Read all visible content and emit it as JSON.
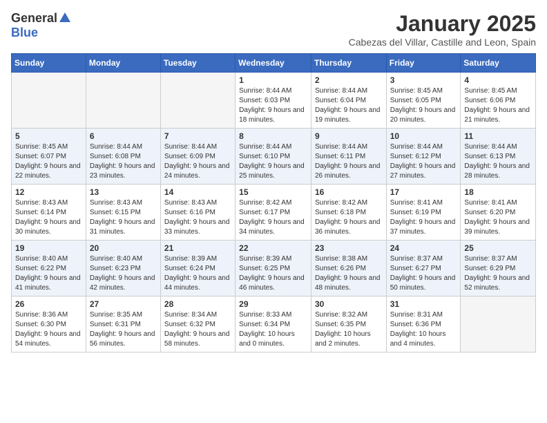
{
  "header": {
    "logo_general": "General",
    "logo_blue": "Blue",
    "month": "January 2025",
    "location": "Cabezas del Villar, Castille and Leon, Spain"
  },
  "weekdays": [
    "Sunday",
    "Monday",
    "Tuesday",
    "Wednesday",
    "Thursday",
    "Friday",
    "Saturday"
  ],
  "weeks": [
    [
      {
        "day": "",
        "info": ""
      },
      {
        "day": "",
        "info": ""
      },
      {
        "day": "",
        "info": ""
      },
      {
        "day": "1",
        "info": "Sunrise: 8:44 AM\nSunset: 6:03 PM\nDaylight: 9 hours and 18 minutes."
      },
      {
        "day": "2",
        "info": "Sunrise: 8:44 AM\nSunset: 6:04 PM\nDaylight: 9 hours and 19 minutes."
      },
      {
        "day": "3",
        "info": "Sunrise: 8:45 AM\nSunset: 6:05 PM\nDaylight: 9 hours and 20 minutes."
      },
      {
        "day": "4",
        "info": "Sunrise: 8:45 AM\nSunset: 6:06 PM\nDaylight: 9 hours and 21 minutes."
      }
    ],
    [
      {
        "day": "5",
        "info": "Sunrise: 8:45 AM\nSunset: 6:07 PM\nDaylight: 9 hours and 22 minutes."
      },
      {
        "day": "6",
        "info": "Sunrise: 8:44 AM\nSunset: 6:08 PM\nDaylight: 9 hours and 23 minutes."
      },
      {
        "day": "7",
        "info": "Sunrise: 8:44 AM\nSunset: 6:09 PM\nDaylight: 9 hours and 24 minutes."
      },
      {
        "day": "8",
        "info": "Sunrise: 8:44 AM\nSunset: 6:10 PM\nDaylight: 9 hours and 25 minutes."
      },
      {
        "day": "9",
        "info": "Sunrise: 8:44 AM\nSunset: 6:11 PM\nDaylight: 9 hours and 26 minutes."
      },
      {
        "day": "10",
        "info": "Sunrise: 8:44 AM\nSunset: 6:12 PM\nDaylight: 9 hours and 27 minutes."
      },
      {
        "day": "11",
        "info": "Sunrise: 8:44 AM\nSunset: 6:13 PM\nDaylight: 9 hours and 28 minutes."
      }
    ],
    [
      {
        "day": "12",
        "info": "Sunrise: 8:43 AM\nSunset: 6:14 PM\nDaylight: 9 hours and 30 minutes."
      },
      {
        "day": "13",
        "info": "Sunrise: 8:43 AM\nSunset: 6:15 PM\nDaylight: 9 hours and 31 minutes."
      },
      {
        "day": "14",
        "info": "Sunrise: 8:43 AM\nSunset: 6:16 PM\nDaylight: 9 hours and 33 minutes."
      },
      {
        "day": "15",
        "info": "Sunrise: 8:42 AM\nSunset: 6:17 PM\nDaylight: 9 hours and 34 minutes."
      },
      {
        "day": "16",
        "info": "Sunrise: 8:42 AM\nSunset: 6:18 PM\nDaylight: 9 hours and 36 minutes."
      },
      {
        "day": "17",
        "info": "Sunrise: 8:41 AM\nSunset: 6:19 PM\nDaylight: 9 hours and 37 minutes."
      },
      {
        "day": "18",
        "info": "Sunrise: 8:41 AM\nSunset: 6:20 PM\nDaylight: 9 hours and 39 minutes."
      }
    ],
    [
      {
        "day": "19",
        "info": "Sunrise: 8:40 AM\nSunset: 6:22 PM\nDaylight: 9 hours and 41 minutes."
      },
      {
        "day": "20",
        "info": "Sunrise: 8:40 AM\nSunset: 6:23 PM\nDaylight: 9 hours and 42 minutes."
      },
      {
        "day": "21",
        "info": "Sunrise: 8:39 AM\nSunset: 6:24 PM\nDaylight: 9 hours and 44 minutes."
      },
      {
        "day": "22",
        "info": "Sunrise: 8:39 AM\nSunset: 6:25 PM\nDaylight: 9 hours and 46 minutes."
      },
      {
        "day": "23",
        "info": "Sunrise: 8:38 AM\nSunset: 6:26 PM\nDaylight: 9 hours and 48 minutes."
      },
      {
        "day": "24",
        "info": "Sunrise: 8:37 AM\nSunset: 6:27 PM\nDaylight: 9 hours and 50 minutes."
      },
      {
        "day": "25",
        "info": "Sunrise: 8:37 AM\nSunset: 6:29 PM\nDaylight: 9 hours and 52 minutes."
      }
    ],
    [
      {
        "day": "26",
        "info": "Sunrise: 8:36 AM\nSunset: 6:30 PM\nDaylight: 9 hours and 54 minutes."
      },
      {
        "day": "27",
        "info": "Sunrise: 8:35 AM\nSunset: 6:31 PM\nDaylight: 9 hours and 56 minutes."
      },
      {
        "day": "28",
        "info": "Sunrise: 8:34 AM\nSunset: 6:32 PM\nDaylight: 9 hours and 58 minutes."
      },
      {
        "day": "29",
        "info": "Sunrise: 8:33 AM\nSunset: 6:34 PM\nDaylight: 10 hours and 0 minutes."
      },
      {
        "day": "30",
        "info": "Sunrise: 8:32 AM\nSunset: 6:35 PM\nDaylight: 10 hours and 2 minutes."
      },
      {
        "day": "31",
        "info": "Sunrise: 8:31 AM\nSunset: 6:36 PM\nDaylight: 10 hours and 4 minutes."
      },
      {
        "day": "",
        "info": ""
      }
    ]
  ]
}
